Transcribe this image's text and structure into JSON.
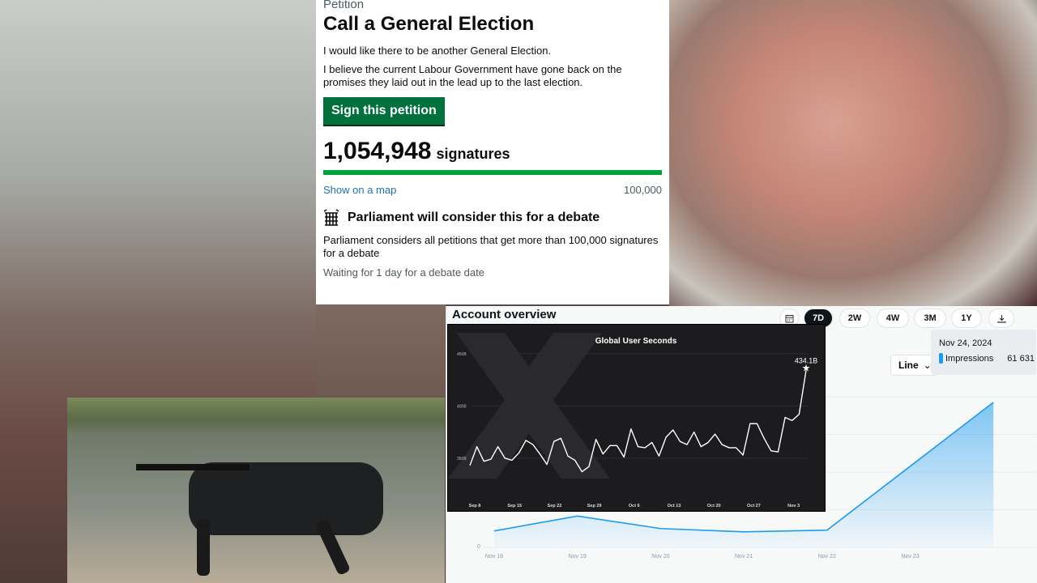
{
  "petition": {
    "caption": "Petition",
    "title": "Call a General Election",
    "paragraphs": [
      "I would like there to be another General Election.",
      "I believe the current Labour Government have gone back on the promises they laid out in the lead up to the last election."
    ],
    "sign_label": "Sign this petition",
    "signature_count": "1,054,948",
    "signature_label": "signatures",
    "progress_percent": 100,
    "map_link": "Show on a map",
    "threshold": "100,000",
    "debate_heading": "Parliament will consider this for a debate",
    "debate_text": "Parliament considers all petitions that get more than 100,000 signatures for a debate",
    "waiting": "Waiting for 1 day for a debate date",
    "accent": "#00703c"
  },
  "account": {
    "title": "Account overview",
    "ranges": [
      "7D",
      "2W",
      "4W",
      "3M",
      "1Y"
    ],
    "selected_range": "7D",
    "chart_type_select": "Line",
    "tooltip": {
      "date": "Nov 24, 2024",
      "label": "Impressions",
      "value": "61 631"
    }
  },
  "chart_data": [
    {
      "type": "area",
      "x": [
        "Nov 18",
        "Nov 19",
        "Nov 20",
        "Nov 21",
        "Nov 22",
        "Nov 23",
        "Nov 24"
      ],
      "tick_labels": [
        "Nov 18",
        "Nov 19",
        "Nov 20",
        "Nov 21",
        "Nov 22",
        "Nov 23"
      ],
      "y_tick_labels": [
        "0"
      ],
      "series": [
        {
          "name": "Impressions",
          "values": [
            7000,
            13300,
            8000,
            6600,
            7300,
            34500,
            61631
          ]
        }
      ],
      "ylim": [
        0,
        75000
      ],
      "grid": true,
      "color": "#1d9bf0"
    },
    {
      "type": "line",
      "title": "Global User Seconds",
      "x_tick_labels": [
        "Sep 8",
        "Sep 15",
        "Sep 22",
        "Sep 29",
        "Oct 6",
        "Oct 13",
        "Oct 20",
        "Oct 27",
        "Nov 3"
      ],
      "y_tick_labels": [
        "350B",
        "400B",
        "450B"
      ],
      "ylim": [
        315,
        470
      ],
      "grid": true,
      "annotation": "434.1B",
      "color": "#ffffff",
      "values": [
        343,
        361,
        347,
        349,
        361,
        350,
        348,
        355,
        367,
        363,
        354,
        344,
        366,
        369,
        352,
        348,
        337,
        342,
        368,
        354,
        362,
        362,
        351,
        378,
        361,
        360,
        365,
        352,
        370,
        377,
        366,
        363,
        375,
        361,
        365,
        373,
        363,
        360,
        360,
        353,
        383,
        383,
        369,
        357,
        356,
        389,
        386,
        392,
        434.1
      ]
    }
  ]
}
